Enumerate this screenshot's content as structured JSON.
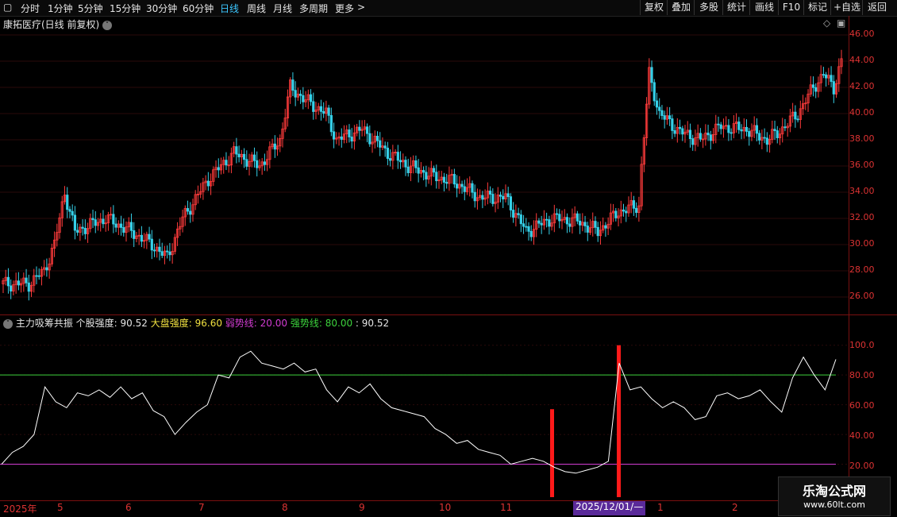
{
  "toolbar": {
    "periods": [
      "分时",
      "1分钟",
      "5分钟",
      "15分钟",
      "30分钟",
      "60分钟",
      "日线",
      "周线",
      "月线",
      "多周期",
      "更多"
    ],
    "active_period": "日线",
    "right_buttons": [
      "复权",
      "叠加",
      "多股",
      "统计",
      "画线",
      "F10",
      "标记",
      "+自选",
      "返回"
    ]
  },
  "main_panel": {
    "title": "康拓医疗(日线 前复权)",
    "price_axis": [
      "46.00",
      "44.00",
      "42.00",
      "40.00",
      "38.00",
      "36.00",
      "34.00",
      "32.00",
      "30.00",
      "28.00",
      "26.00"
    ]
  },
  "indicator_panel": {
    "name": "主力吸筹共振",
    "stock_strength_label": "个股强度:",
    "stock_strength_value": "90.52",
    "market_strength_label": "大盘强度:",
    "market_strength_value": "96.60",
    "weak_line_label": "弱势线:",
    "weak_line_value": "20.00",
    "strong_line_label": "强势线:",
    "strong_line_value": "80.00",
    "extra_value": ": 90.52",
    "axis": [
      "100.0",
      "80.00",
      "60.00",
      "40.00",
      "20.00"
    ]
  },
  "time_axis": {
    "labels": [
      "2025年",
      "5",
      "6",
      "7",
      "8",
      "9",
      "10",
      "11",
      "1",
      "2"
    ],
    "cursor_label": "2025/12/01/—"
  },
  "watermark": {
    "line1": "乐淘公式网",
    "line2": "www.60lt.com"
  },
  "colors": {
    "up": "#ff3b3b",
    "down": "#35d0e8",
    "strong_line": "#3cd23c",
    "weak_line": "#d23cd2",
    "signal": "#ff1a1a",
    "strength_line": "#ffffff"
  },
  "chart_data": [
    {
      "type": "line",
      "title": "主力吸筹共振",
      "series": [
        {
          "name": "个股强度",
          "values": [
            20,
            28,
            32,
            40,
            72,
            62,
            58,
            68,
            66,
            70,
            65,
            72,
            64,
            68,
            56,
            52,
            40,
            48,
            55,
            60,
            80,
            78,
            92,
            96,
            88,
            86,
            84,
            88,
            82,
            84,
            70,
            62,
            72,
            68,
            74,
            64,
            58,
            56,
            54,
            52,
            44,
            40,
            34,
            36,
            30,
            28,
            26,
            20,
            22,
            24,
            22,
            18,
            15,
            14,
            16,
            18,
            22,
            88,
            70,
            72,
            64,
            58,
            62,
            58,
            50,
            52,
            66,
            68,
            64,
            66,
            70,
            62,
            55,
            78,
            92,
            80,
            70,
            90.52
          ]
        }
      ],
      "reference_lines": [
        {
          "name": "强势线",
          "value": 80
        },
        {
          "name": "弱势线",
          "value": 20
        }
      ],
      "ylim": [
        0,
        110
      ]
    }
  ]
}
